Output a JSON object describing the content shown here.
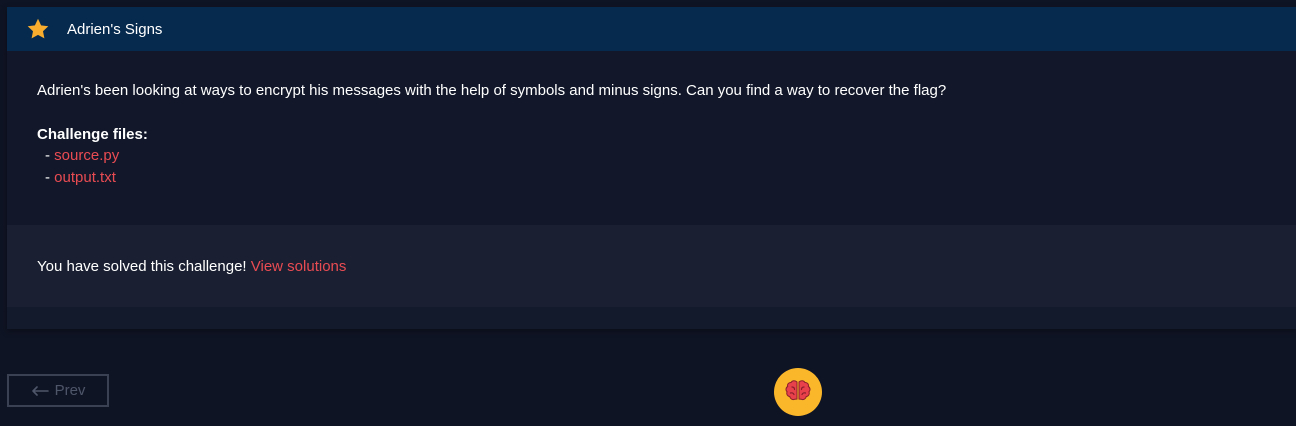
{
  "challenge": {
    "title": "Adrien's Signs",
    "description": "Adrien's been looking at ways to encrypt his messages with the help of symbols and minus signs. Can you find a way to recover the flag?",
    "files_heading": "Challenge files:",
    "files": [
      {
        "prefix": "- ",
        "name": "source.py"
      },
      {
        "prefix": "- ",
        "name": "output.txt"
      }
    ],
    "solved_text": "You have solved this challenge! ",
    "solutions_link": "View solutions"
  },
  "nav": {
    "prev_label": "Prev"
  },
  "icons": {
    "header": "star-icon",
    "prev": "arrow-left-icon",
    "badge": "brain-icon"
  },
  "colors": {
    "page_bg": "#0f1424",
    "header_bg": "#062a4e",
    "link": "#e94b53",
    "star": "#f9ad2f",
    "badge_bg": "#fbb72a",
    "brain": "#e8414b"
  }
}
